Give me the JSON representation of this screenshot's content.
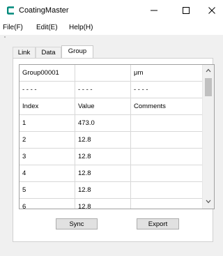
{
  "window": {
    "title": "CoatingMaster",
    "minimize_icon": "minimize-icon",
    "maximize_icon": "maximize-icon",
    "close_icon": "close-icon",
    "app_icon": "coatingmaster-logo-icon",
    "brand_color": "#00897b"
  },
  "menu": {
    "items": [
      "File(F)",
      "Edit(E)",
      "Help(H)"
    ]
  },
  "tabs": [
    {
      "label": "Link",
      "active": false
    },
    {
      "label": "Data",
      "active": false
    },
    {
      "label": "Group",
      "active": true
    }
  ],
  "grid": {
    "rows": [
      [
        "Group00001",
        "",
        "μm"
      ],
      [
        "- - - -",
        "- - - -",
        "- - - -"
      ],
      [
        "Index",
        "Value",
        "Comments"
      ],
      [
        "1",
        "473.0",
        ""
      ],
      [
        "2",
        "12.8",
        ""
      ],
      [
        "3",
        "12.8",
        ""
      ],
      [
        "4",
        "12.8",
        ""
      ],
      [
        "5",
        "12.8",
        ""
      ],
      [
        "6",
        "12.8",
        ""
      ]
    ]
  },
  "buttons": {
    "sync": "Sync",
    "export": "Export"
  }
}
